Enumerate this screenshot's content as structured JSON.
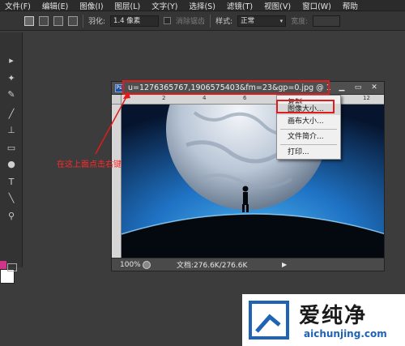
{
  "menubar": {
    "items": [
      "文件(F)",
      "编辑(E)",
      "图像(I)",
      "图层(L)",
      "文字(Y)",
      "选择(S)",
      "滤镜(T)",
      "视图(V)",
      "窗口(W)",
      "帮助"
    ]
  },
  "options": {
    "feather_label": "羽化:",
    "feather_value": "1.4 像素",
    "antialias_label": "消除锯齿",
    "style_label": "样式:",
    "style_value": "正常",
    "width_label": "宽度:"
  },
  "document": {
    "title": "u=1276365767,1906575403&fm=23&gp=0.jpg @ 1",
    "ruler_ticks": [
      "2",
      "4",
      "6",
      "8",
      "10",
      "12"
    ],
    "zoom": "100%",
    "doc_info": "文档:276.6K/276.6K",
    "ps_icon_label": "Ps"
  },
  "context_menu": {
    "items": [
      "复制",
      "图像大小...",
      "画布大小...",
      "文件简介...",
      "打印..."
    ],
    "selected_index": 1
  },
  "annotation": {
    "text": "在这上面点击右键"
  },
  "watermark": {
    "brand_cn": "爱纯净",
    "brand_en": "aichunjing.com"
  },
  "colors": {
    "foreground": "#d0358a",
    "background": "#ffffff",
    "highlight": "#e01b1b"
  }
}
